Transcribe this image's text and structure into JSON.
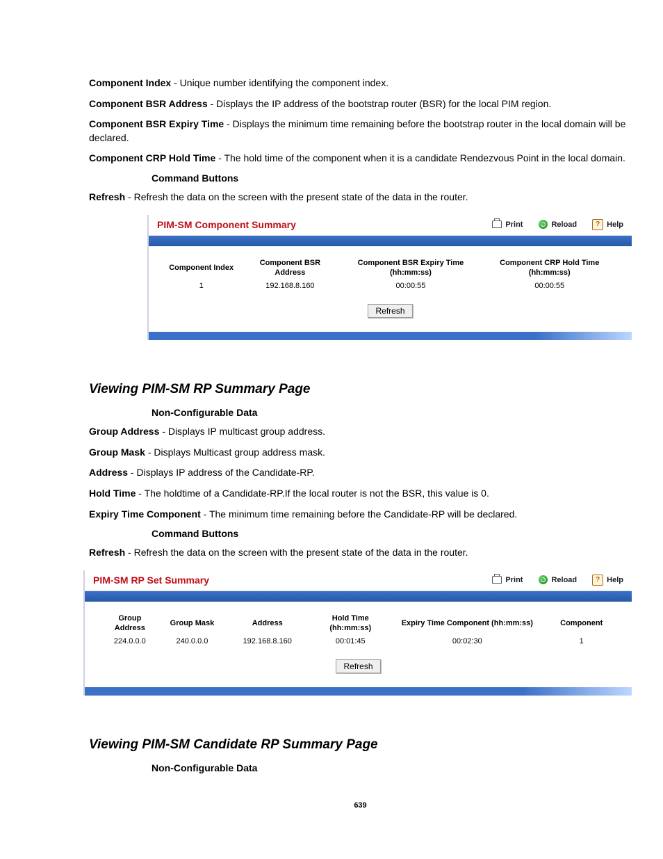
{
  "intro": {
    "fields": [
      {
        "term": "Component Index",
        "desc": " - Unique number identifying the component index."
      },
      {
        "term": "Component BSR Address",
        "desc": " - Displays the IP address of the bootstrap router (BSR) for the local PIM region."
      },
      {
        "term": "Component BSR Expiry Time",
        "desc": " - Displays the minimum time remaining before the bootstrap router in the local domain will be declared."
      },
      {
        "term": "Component CRP Hold Time",
        "desc": " - The hold time of the component when it is a candidate Rendezvous Point in the local domain."
      }
    ],
    "cmd_heading": "Command Buttons",
    "refresh": {
      "term": "Refresh",
      "desc": " - Refresh the data on the screen with the present state of the data in the router."
    }
  },
  "panel1": {
    "title": "PIM-SM Component Summary",
    "actions": {
      "print": "Print",
      "reload": "Reload",
      "help": "Help"
    },
    "headers": [
      "Component Index",
      "Component BSR Address",
      "Component BSR Expiry Time (hh:mm:ss)",
      "Component CRP Hold Time (hh:mm:ss)"
    ],
    "row": [
      "1",
      "192.168.8.160",
      "00:00:55",
      "00:00:55"
    ],
    "refresh_btn": "Refresh"
  },
  "section2": {
    "title": "Viewing PIM-SM RP Summary Page",
    "nc_heading": "Non-Configurable Data",
    "fields": [
      {
        "term": "Group Address",
        "desc": " - Displays IP multicast group address."
      },
      {
        "term": "Group Mask",
        "desc": " - Displays Multicast group address mask."
      },
      {
        "term": "Address",
        "desc": " - Displays IP address of the Candidate-RP."
      },
      {
        "term": "Hold Time",
        "desc": " - The holdtime of a Candidate-RP.If the local router is not the BSR, this value is 0."
      },
      {
        "term": "Expiry Time Component",
        "desc": " - The minimum time remaining before the Candidate-RP will be declared."
      }
    ],
    "cmd_heading": "Command Buttons",
    "refresh": {
      "term": "Refresh",
      "desc": " - Refresh the data on the screen with the present state of the data in the router."
    }
  },
  "panel2": {
    "title": "PIM-SM RP Set Summary",
    "actions": {
      "print": "Print",
      "reload": "Reload",
      "help": "Help"
    },
    "headers": [
      "Group Address",
      "Group Mask",
      "Address",
      "Hold Time (hh:mm:ss)",
      "Expiry Time Component (hh:mm:ss)",
      "Component"
    ],
    "row": [
      "224.0.0.0",
      "240.0.0.0",
      "192.168.8.160",
      "00:01:45",
      "00:02:30",
      "1"
    ],
    "refresh_btn": "Refresh"
  },
  "section3": {
    "title": "Viewing PIM-SM Candidate RP Summary Page",
    "nc_heading": "Non-Configurable Data"
  },
  "page_number": "639"
}
